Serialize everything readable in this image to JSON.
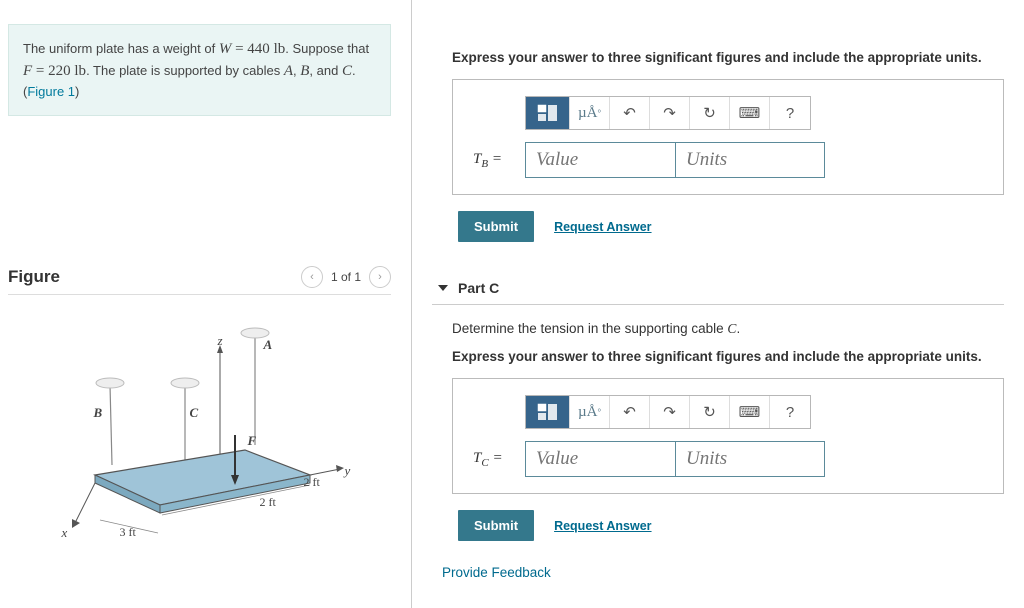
{
  "problem": {
    "text1a": "The uniform plate has a weight of ",
    "w_var": "W",
    "eq": " = 440 ",
    "w_unit": "lb",
    "text1b": ". Suppose that ",
    "f_var": "F",
    "f_eq": " = 220 ",
    "f_unit": "lb",
    "text1c": ". The plate is supported by cables ",
    "a_var": "A",
    "b_var": "B",
    "and": ", and ",
    "c_var": "C",
    "text1d": ". (",
    "fig_link": "Figure 1",
    "text1e": ")"
  },
  "figure": {
    "heading": "Figure",
    "counter": "1 of 1",
    "labels": {
      "z": "z",
      "A": "A",
      "B": "B",
      "C": "C",
      "F": "F",
      "y": "y",
      "x": "x",
      "d2a": "2 ft",
      "d2b": "2 ft",
      "d3": "3 ft"
    }
  },
  "partB": {
    "instruction": "Express your answer to three significant figures and include the appropriate units.",
    "toolbar_units": "µÅ",
    "var_label": "T",
    "sub": "B",
    "equals": " = ",
    "value_ph": "Value",
    "units_ph": "Units",
    "submit": "Submit",
    "request": "Request Answer"
  },
  "partC": {
    "heading": "Part C",
    "determine": "Determine the tension in the supporting cable ",
    "cable": "C",
    "period": ".",
    "instruction": "Express your answer to three significant figures and include the appropriate units.",
    "toolbar_units": "µÅ",
    "var_label": "T",
    "sub": "C",
    "equals": " = ",
    "value_ph": "Value",
    "units_ph": "Units",
    "submit": "Submit",
    "request": "Request Answer"
  },
  "feedback_link": "Provide Feedback",
  "icons": {
    "undo": "↶",
    "redo": "↷",
    "refresh": "↻",
    "keyboard": "⌨",
    "help": "?"
  }
}
